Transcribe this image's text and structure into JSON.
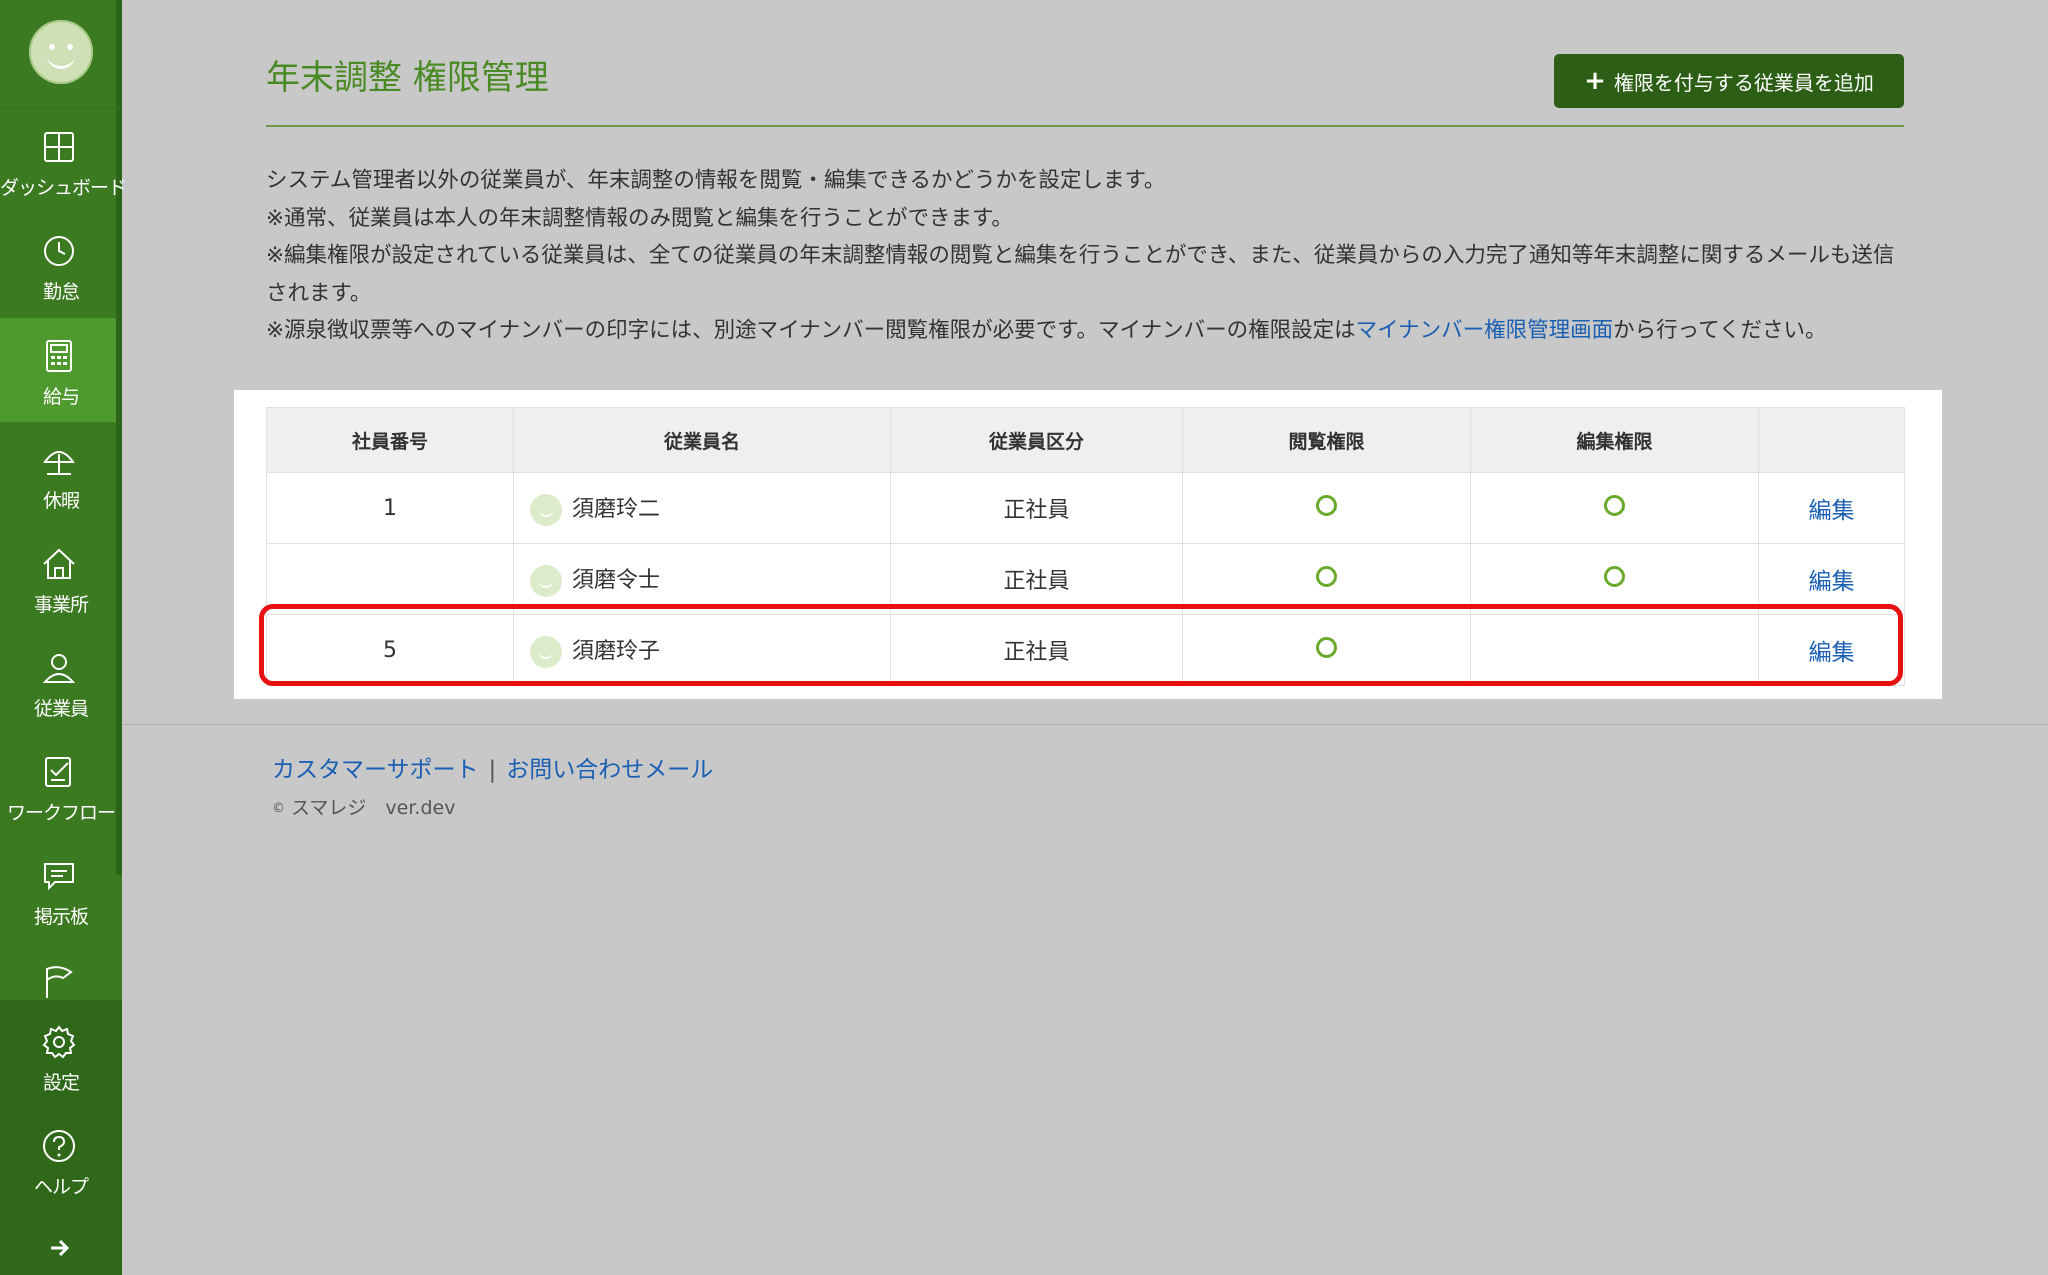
{
  "sidebar": {
    "items": [
      {
        "label": "ダッシュボード",
        "icon": "dashboard-icon"
      },
      {
        "label": "勤怠",
        "icon": "clock-icon"
      },
      {
        "label": "給与",
        "icon": "calculator-icon"
      },
      {
        "label": "休暇",
        "icon": "umbrella-icon"
      },
      {
        "label": "事業所",
        "icon": "home-icon"
      },
      {
        "label": "従業員",
        "icon": "user-icon"
      },
      {
        "label": "ワークフロー",
        "icon": "workflow-icon"
      },
      {
        "label": "掲示板",
        "icon": "chat-icon"
      },
      {
        "label": "",
        "icon": "flag-icon"
      },
      {
        "label": "設定",
        "icon": "gear-icon"
      },
      {
        "label": "ヘルプ",
        "icon": "help-icon"
      }
    ],
    "active_index": 2,
    "collapse_icon": "arrow-right-icon"
  },
  "page": {
    "title": "年末調整 権限管理",
    "add_button_label": "権限を付与する従業員を追加"
  },
  "description": {
    "line1": "システム管理者以外の従業員が、年末調整の情報を閲覧・編集できるかどうかを設定します。",
    "line2": "※通常、従業員は本人の年末調整情報のみ閲覧と編集を行うことができます。",
    "line3": "※編集権限が設定されている従業員は、全ての従業員の年末調整情報の閲覧と編集を行うことができ、また、従業員からの入力完了通知等年末調整に関するメールも送信されます。",
    "line4_prefix": "※源泉徴収票等へのマイナンバーの印字には、別途マイナンバー閲覧権限が必要です。マイナンバーの権限設定は",
    "line4_link": "マイナンバー権限管理画面",
    "line4_suffix": "から行ってください。"
  },
  "table": {
    "headers": [
      "社員番号",
      "従業員名",
      "従業員区分",
      "閲覧権限",
      "編集権限",
      ""
    ],
    "rows": [
      {
        "emp_no": "1",
        "name": "須磨玲二",
        "category": "正社員",
        "view": true,
        "edit": true,
        "action": "編集"
      },
      {
        "emp_no": "",
        "name": "須磨令士",
        "category": "正社員",
        "view": true,
        "edit": true,
        "action": "編集"
      },
      {
        "emp_no": "5",
        "name": "須磨玲子",
        "category": "正社員",
        "view": true,
        "edit": false,
        "action": "編集"
      }
    ]
  },
  "footer": {
    "support_link": "カスタマーサポート",
    "separator": "|",
    "contact_link": "お問い合わせメール",
    "copyright_symbol": "©",
    "copyright": "スマレジ　ver.dev"
  },
  "colors": {
    "sidebar": "#3c7a22",
    "accent_green": "#4a8a24",
    "button": "#2c5e16",
    "link": "#1a5fb4",
    "highlight": "#e81010"
  }
}
